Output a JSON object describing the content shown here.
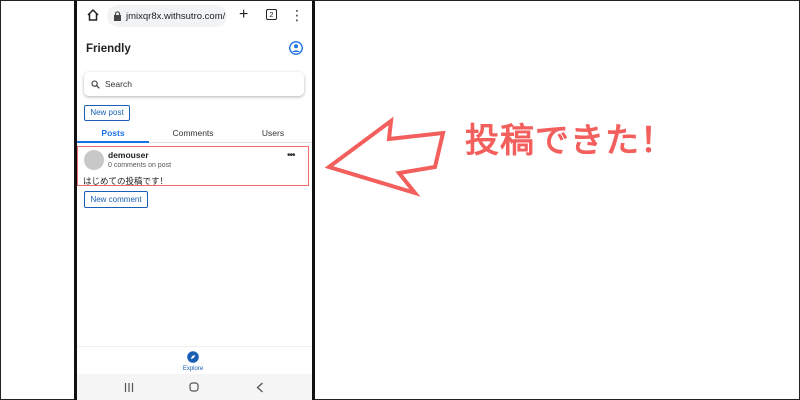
{
  "browser": {
    "url": "jmixqr8x.withsutro.com/",
    "tab_count": "2",
    "icons": {
      "home": "home-icon",
      "lock": "lock-icon",
      "new_tab": "plus-icon",
      "menu": "menu-dots-icon"
    }
  },
  "app": {
    "title": "Friendly",
    "account_icon": "account-circle-icon"
  },
  "search": {
    "placeholder": "Search"
  },
  "new_post_label": "New post",
  "tabs": [
    {
      "label": "Posts",
      "active": true
    },
    {
      "label": "Comments",
      "active": false
    },
    {
      "label": "Users",
      "active": false
    }
  ],
  "post": {
    "username": "demouser",
    "meta": "0 comments on post",
    "body": "はじめての投稿です！",
    "more_icon": "more-horizontal-icon"
  },
  "new_comment_label": "New comment",
  "bottom_nav": {
    "label": "Explore",
    "icon": "compass-icon"
  },
  "annotation": {
    "text": "投稿できた！",
    "color": "#f25f5c"
  },
  "colors": {
    "accent": "#1a73e8",
    "button": "#1a5fb4",
    "highlight": "#f06b6b"
  }
}
